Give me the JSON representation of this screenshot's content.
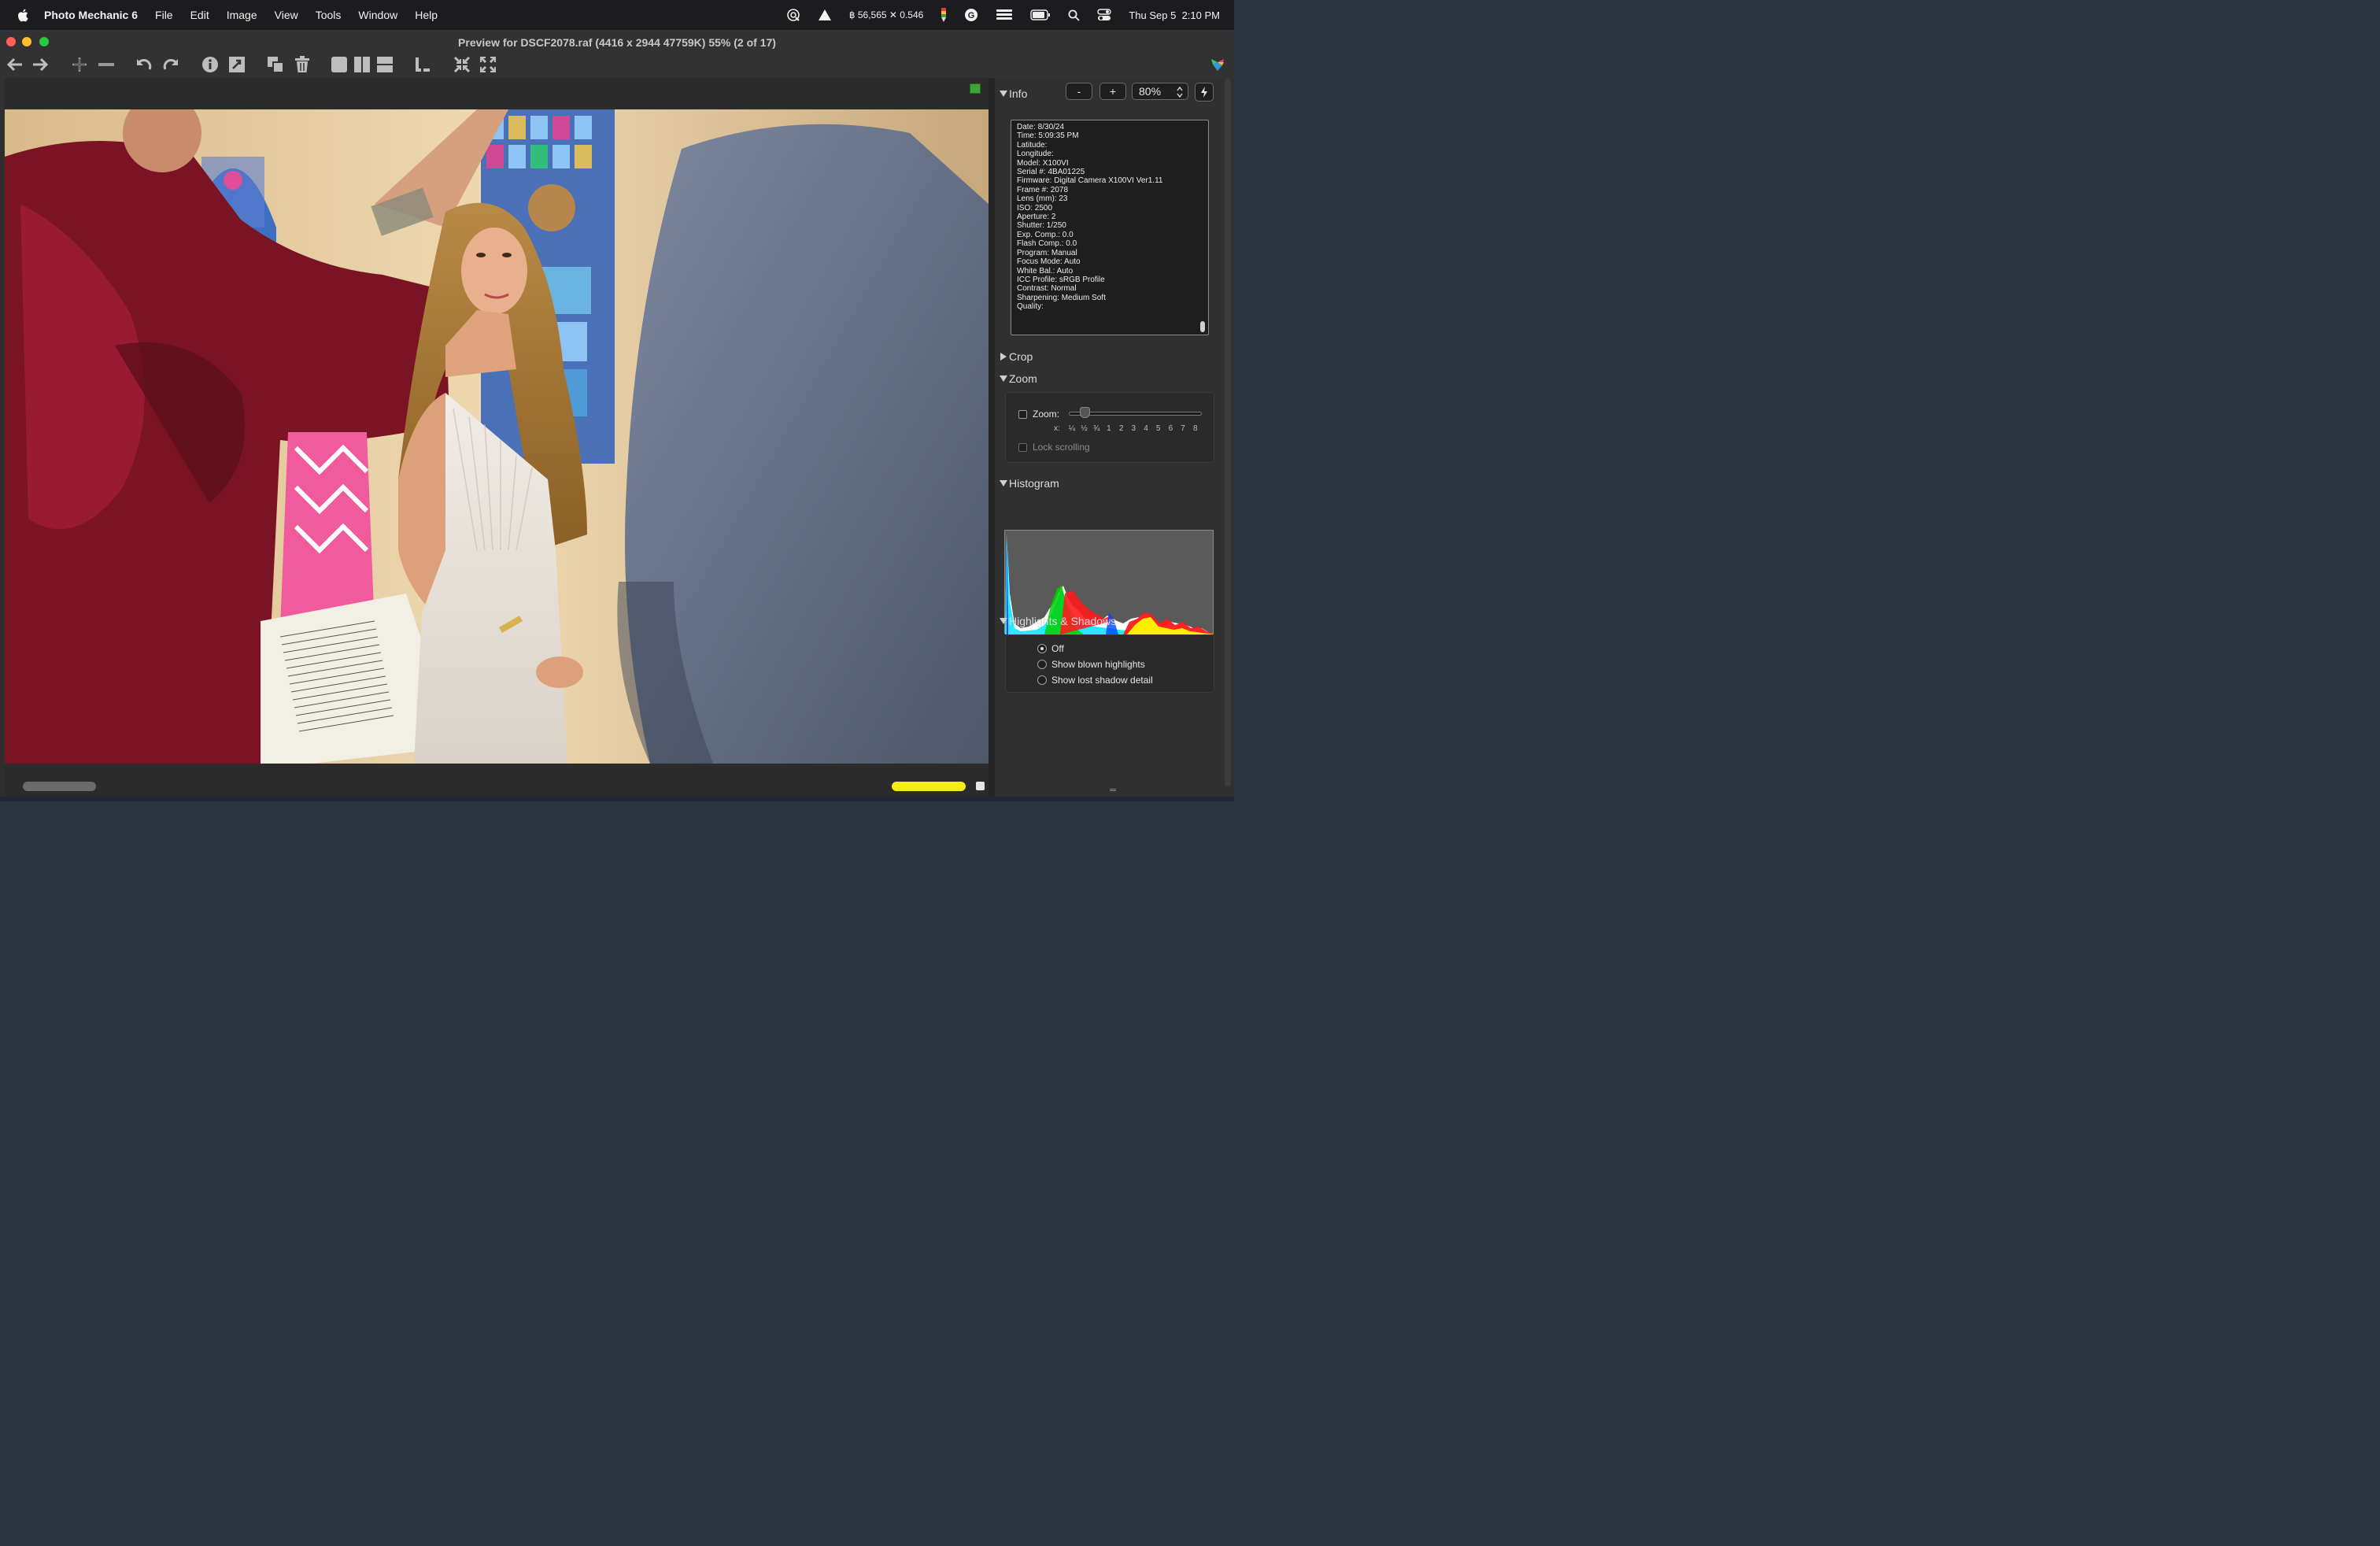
{
  "menubar": {
    "app_name": "Photo Mechanic 6",
    "menus": [
      "File",
      "Edit",
      "Image",
      "View",
      "Tools",
      "Window",
      "Help"
    ],
    "crypto_ticker": "฿ 56,565 ✕ 0.546",
    "date": "Thu Sep 5",
    "time": "2:10 PM"
  },
  "window": {
    "title": "Preview for DSCF2078.raf (4416 x 2944 47759K) 55% (2 of 17)"
  },
  "info": {
    "header": "Info",
    "minus_label": "-",
    "plus_label": "+",
    "zoom_value": "80%",
    "lines": [
      "Date: 8/30/24",
      "Time: 5:09:35 PM",
      "Latitude:",
      "Longitude:",
      "Model: X100VI",
      "Serial #: 4BA01225",
      "Firmware: Digital Camera X100VI Ver1.11",
      "Frame #: 2078",
      "Lens (mm): 23",
      "ISO: 2500",
      "Aperture: 2",
      "Shutter: 1/250",
      "Exp. Comp.: 0.0",
      "Flash Comp.: 0.0",
      "Program: Manual",
      "Focus Mode: Auto",
      "White Bal.: Auto",
      "ICC Profile: sRGB Profile",
      "Contrast: Normal",
      "Sharpening: Medium Soft",
      "Quality:"
    ]
  },
  "crop": {
    "header": "Crop"
  },
  "zoom": {
    "header": "Zoom",
    "zoom_label": "Zoom:",
    "x_label": "x:",
    "ticks": [
      "¼",
      "½",
      "¾",
      "1",
      "2",
      "3",
      "4",
      "5",
      "6",
      "7",
      "8"
    ],
    "lock_label": "Lock scrolling"
  },
  "histogram": {
    "header": "Histogram"
  },
  "highlights": {
    "header": "Highlights & Shadows",
    "options": [
      "Off",
      "Show blown highlights",
      "Show lost shadow detail"
    ],
    "selected": "Off"
  },
  "colors": {
    "accent_green": "#3fa33a",
    "yellow_bar": "#f4ec1a"
  }
}
